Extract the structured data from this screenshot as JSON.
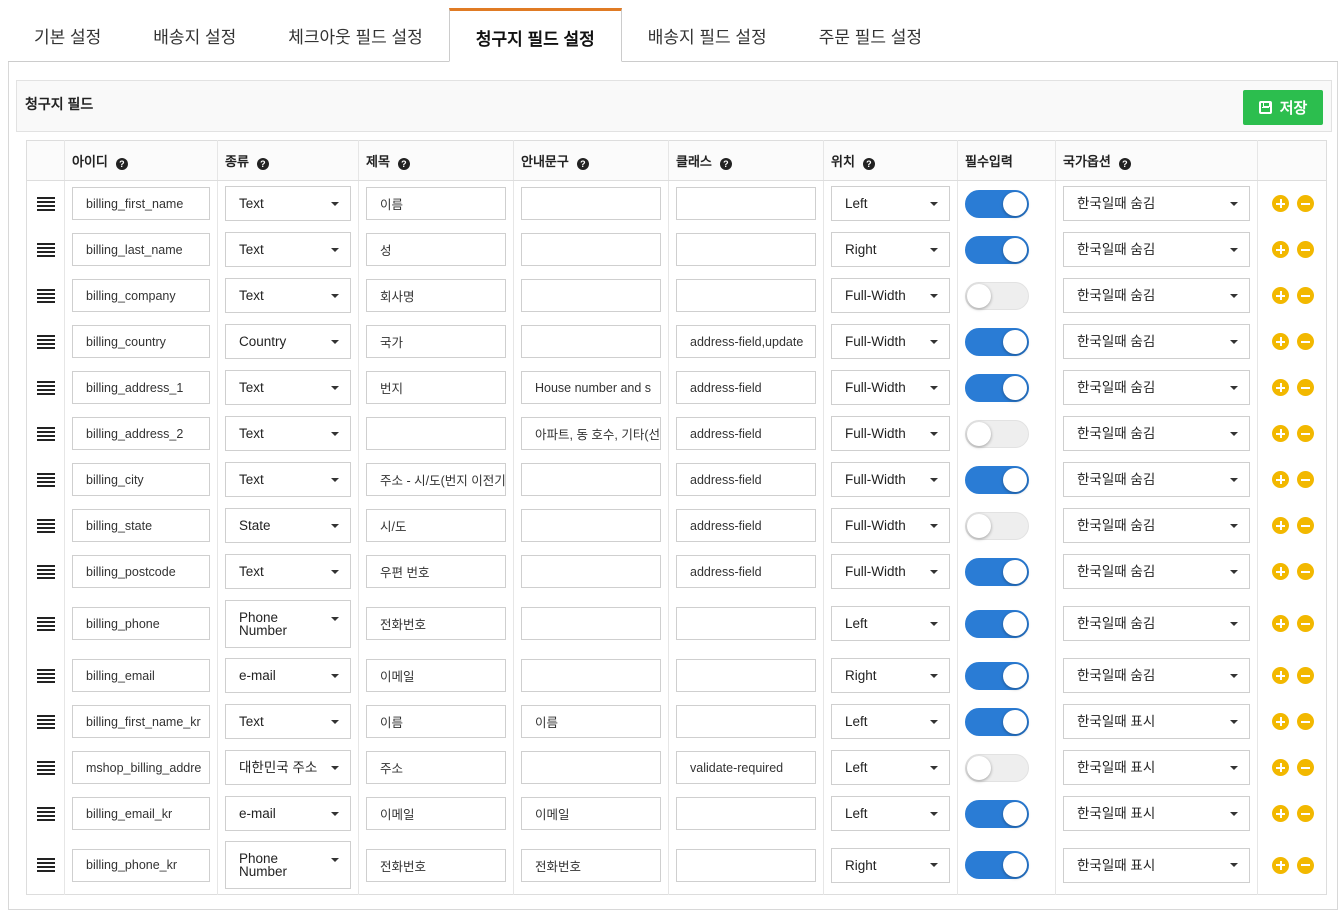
{
  "tabs": [
    {
      "label": "기본 설정",
      "active": false
    },
    {
      "label": "배송지 설정",
      "active": false
    },
    {
      "label": "체크아웃 필드 설정",
      "active": false
    },
    {
      "label": "청구지 필드 설정",
      "active": true
    },
    {
      "label": "배송지 필드 설정",
      "active": false
    },
    {
      "label": "주문 필드 설정",
      "active": false
    }
  ],
  "section": {
    "title": "청구지 필드",
    "save_label": "저장"
  },
  "columns": {
    "id": "아이디",
    "type": "종류",
    "title": "제목",
    "placeholder": "안내문구",
    "class": "클래스",
    "position": "위치",
    "required": "필수입력",
    "country": "국가옵션",
    "help_icon": "?"
  },
  "rows": [
    {
      "id": "billing_first_name",
      "type": "Text",
      "title": "이름",
      "placeholder": "",
      "class": "",
      "position": "Left",
      "required": true,
      "country": "한국일때 숨김"
    },
    {
      "id": "billing_last_name",
      "type": "Text",
      "title": "성",
      "placeholder": "",
      "class": "",
      "position": "Right",
      "required": true,
      "country": "한국일때 숨김"
    },
    {
      "id": "billing_company",
      "type": "Text",
      "title": "회사명",
      "placeholder": "",
      "class": "",
      "position": "Full-Width",
      "required": false,
      "country": "한국일때 숨김"
    },
    {
      "id": "billing_country",
      "type": "Country",
      "title": "국가",
      "placeholder": "",
      "class": "address-field,update",
      "position": "Full-Width",
      "required": true,
      "country": "한국일때 숨김"
    },
    {
      "id": "billing_address_1",
      "type": "Text",
      "title": "번지",
      "placeholder": "House number and s",
      "class": "address-field",
      "position": "Full-Width",
      "required": true,
      "country": "한국일때 숨김"
    },
    {
      "id": "billing_address_2",
      "type": "Text",
      "title": "",
      "placeholder": "아파트, 동 호수, 기타(선",
      "class": "address-field",
      "position": "Full-Width",
      "required": false,
      "country": "한국일때 숨김"
    },
    {
      "id": "billing_city",
      "type": "Text",
      "title": "주소 - 시/도(번지 이전기",
      "placeholder": "",
      "class": "address-field",
      "position": "Full-Width",
      "required": true,
      "country": "한국일때 숨김"
    },
    {
      "id": "billing_state",
      "type": "State",
      "title": "시/도",
      "placeholder": "",
      "class": "address-field",
      "position": "Full-Width",
      "required": false,
      "country": "한국일때 숨김"
    },
    {
      "id": "billing_postcode",
      "type": "Text",
      "title": "우편 번호",
      "placeholder": "",
      "class": "address-field",
      "position": "Full-Width",
      "required": true,
      "country": "한국일때 숨김"
    },
    {
      "id": "billing_phone",
      "type": "Phone Number",
      "title": "전화번호",
      "placeholder": "",
      "class": "",
      "position": "Left",
      "required": true,
      "country": "한국일때 숨김"
    },
    {
      "id": "billing_email",
      "type": "e-mail",
      "title": "이메일",
      "placeholder": "",
      "class": "",
      "position": "Right",
      "required": true,
      "country": "한국일때 숨김"
    },
    {
      "id": "billing_first_name_kr",
      "type": "Text",
      "title": "이름",
      "placeholder": "이름",
      "class": "",
      "position": "Left",
      "required": true,
      "country": "한국일때 표시"
    },
    {
      "id": "mshop_billing_addre",
      "type": "대한민국 주소",
      "title": "주소",
      "placeholder": "",
      "class": "validate-required",
      "position": "Left",
      "required": false,
      "country": "한국일때 표시"
    },
    {
      "id": "billing_email_kr",
      "type": "e-mail",
      "title": "이메일",
      "placeholder": "이메일",
      "class": "",
      "position": "Left",
      "required": true,
      "country": "한국일때 표시"
    },
    {
      "id": "billing_phone_kr",
      "type": "Phone Number",
      "title": "전화번호",
      "placeholder": "전화번호",
      "class": "",
      "position": "Right",
      "required": true,
      "country": "한국일때 표시"
    }
  ],
  "icons": {
    "drag": "drag-handle-icon",
    "save": "floppy-disk-icon",
    "help": "question-circle-icon",
    "add": "plus-circle-icon",
    "remove": "minus-circle-icon",
    "caret": "caret-down-icon"
  },
  "colors": {
    "active_tab_border": "#e07b24",
    "save_button": "#2cbe4e",
    "toggle_on": "#2a7cd5",
    "action_icons": "#f2b800"
  }
}
